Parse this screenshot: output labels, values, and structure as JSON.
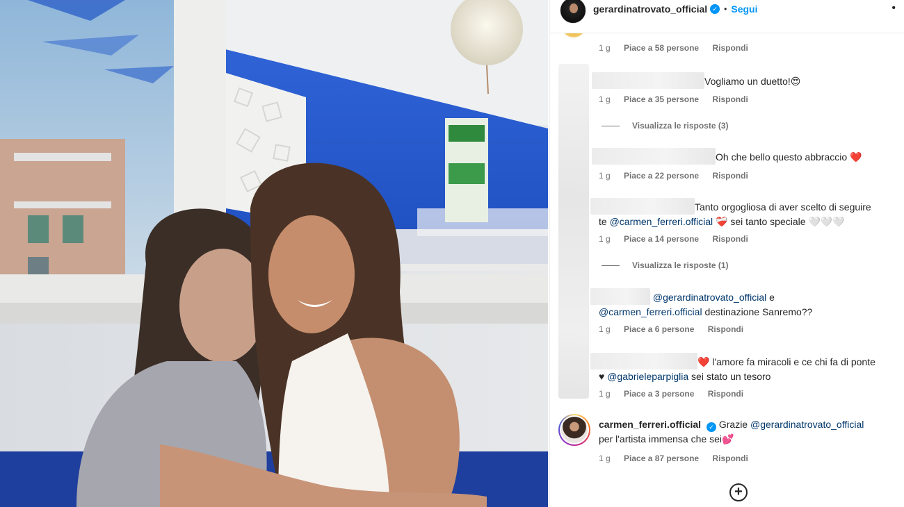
{
  "post": {
    "username": "gerardinatrovato_official",
    "follow_label": "Segui",
    "separator": "•",
    "more_icon": "more-dots-icon"
  },
  "comments": [
    {
      "time": "1 g",
      "likes": "Piace a 58 persone",
      "reply": "Rispondi"
    },
    {
      "text": "Vogliamo un duetto!",
      "emoji": "😍",
      "time": "1 g",
      "likes": "Piace a 35 persone",
      "reply": "Rispondi",
      "view_replies": "Visualizza le risposte (3)"
    },
    {
      "text": "Oh che bello questo abbraccio",
      "emoji": "❤️",
      "time": "1 g",
      "likes": "Piace a 22 persone",
      "reply": "Rispondi"
    },
    {
      "text_1": "Tanto orgogliosa di aver scelto di seguire",
      "text_2": "te",
      "mention": "@carmen_ferreri.official",
      "emoji": "❤️‍🩹",
      "text_3": "sei tanto speciale",
      "hearts": "🤍🤍🤍",
      "time": "1 g",
      "likes": "Piace a 14 persone",
      "reply": "Rispondi",
      "view_replies": "Visualizza le risposte (1)"
    },
    {
      "mention_1": "@gerardinatrovato_official",
      "text_1": "e",
      "mention_2": "@carmen_ferreri.official",
      "text_2": "destinazione Sanremo??",
      "time": "1 g",
      "likes": "Piace a 6 persone",
      "reply": "Rispondi"
    },
    {
      "emoji": "❤️",
      "text_1": "l'amore fa miracoli e ce chi fa di ponte",
      "heart": "♥",
      "mention": "@gabrieleparpiglia",
      "text_2": "sei stato un tesoro",
      "time": "1 g",
      "likes": "Piace a 3 persone",
      "reply": "Rispondi"
    },
    {
      "username": "carmen_ferreri.official",
      "text_1": "Grazie",
      "mention": "@gerardinatrovato_official",
      "text_2": "per l'artista immensa che sei",
      "emoji": "💕",
      "time": "1 g",
      "likes": "Piace a 87 persone",
      "reply": "Rispondi"
    }
  ],
  "load_more_icon": "plus-circle-icon",
  "load_more_glyph": "+"
}
